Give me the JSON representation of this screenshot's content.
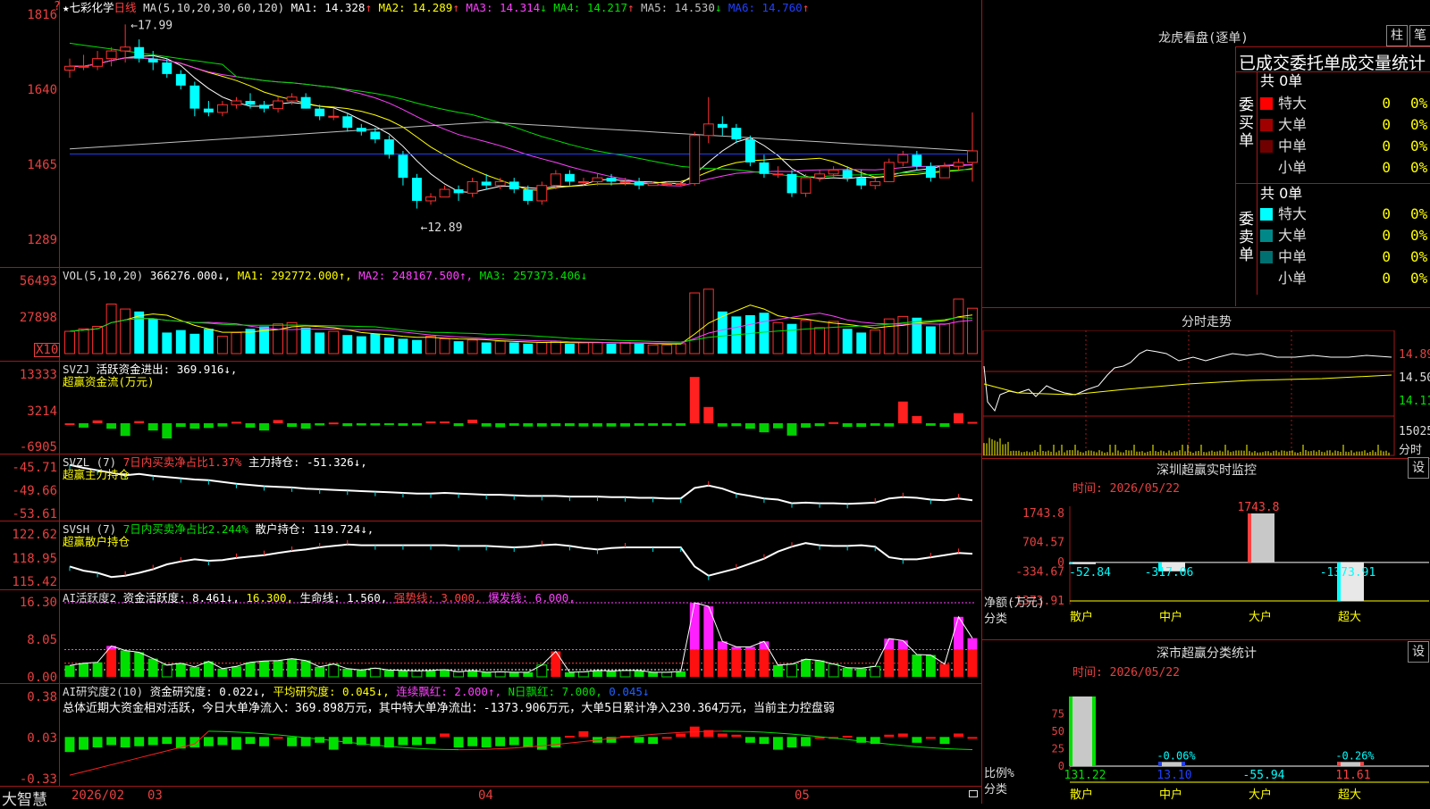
{
  "app": {
    "brand": "大智慧",
    "stock_name": "七彩化学",
    "period": "日线",
    "corner_marker": "?",
    "star": "★"
  },
  "price_pane": {
    "ma_params": "MA(5,10,20,30,60,120)",
    "ma": [
      {
        "label": "MA1:",
        "value": "14.328",
        "dir": "↑",
        "color": "#ffffff"
      },
      {
        "label": "MA2:",
        "value": "14.289",
        "dir": "↑",
        "color": "#ffff00"
      },
      {
        "label": "MA3:",
        "value": "14.314",
        "dir": "↓",
        "color": "#ff40ff"
      },
      {
        "label": "MA4:",
        "value": "14.217",
        "dir": "↑",
        "color": "#00e000"
      },
      {
        "label": "MA5:",
        "value": "14.530",
        "dir": "↓",
        "color": "#c0c0c0"
      },
      {
        "label": "MA6:",
        "value": "14.760",
        "dir": "↑",
        "color": "#2040ff"
      }
    ],
    "y_ticks": [
      "1816",
      "1640",
      "1465",
      "1289"
    ],
    "high_label": "17.99",
    "low_label": "12.89"
  },
  "volume_pane": {
    "title": "VOL(5,10,20)",
    "value": "366276.000↓,",
    "ma": [
      {
        "label": "MA1:",
        "value": "292772.000↑,",
        "color": "#ffff00"
      },
      {
        "label": "MA2:",
        "value": "248167.500↑,",
        "color": "#ff40ff"
      },
      {
        "label": "MA3:",
        "value": "257373.406↓",
        "color": "#00e000"
      }
    ],
    "y_ticks": [
      "56493",
      "27898"
    ],
    "unit": "X10"
  },
  "svzj_pane": {
    "title": "SVZJ",
    "line1": "活跃资金进出: 369.916↓,",
    "line2": "超赢资金流(万元)",
    "y_ticks": [
      "13333",
      "3214",
      "-6905"
    ]
  },
  "svzl_pane": {
    "title": "SVZL (7)",
    "part1": "7日内买卖净占比1.37%",
    "part2": "主力持仓: -51.326↓,",
    "line2": "超赢主力持仓",
    "y_ticks": [
      "-45.71",
      "-49.66",
      "-53.61"
    ]
  },
  "svsh_pane": {
    "title": "SVSH (7)",
    "part1": "7日内买卖净占比2.244%",
    "part2": "散户持仓: 119.724↓,",
    "line2": "超赢散户持仓",
    "y_ticks": [
      "122.62",
      "118.95",
      "115.42"
    ]
  },
  "ai_active_pane": {
    "title": "AI活跃度2",
    "part1": "资金活跃度: 8.461↓,",
    "part2": "16.300,",
    "part3": "生命线: 1.560,",
    "part4": "强势线: 3.000,",
    "part5": "爆发线: 6.000,",
    "y_ticks": [
      "16.30",
      "8.05",
      "0.00"
    ]
  },
  "ai_research_pane": {
    "title": "AI研究度2(10)",
    "part1": "资金研究度: 0.022↓,",
    "part2": "平均研究度: 0.045↓,",
    "part3": "连续飘红: 2.000↑,",
    "part4": "N日飘红: 7.000,",
    "part5": "0.045↓",
    "summary": "总体近期大资金相对活跃，今日大单净流入：369.898万元，其中特大单净流出：-1373.906万元，大单5日累计净入230.364万元，当前主力控盘弱",
    "y_ticks": [
      "0.38",
      "0.03",
      "-0.33"
    ]
  },
  "x_axis": {
    "labels": [
      "2026/02",
      "03",
      "04",
      "05"
    ]
  },
  "right_panel": {
    "dragon_title": "龙虎看盘(逐单)",
    "btn_column": "柱",
    "btn_detail": "笔",
    "stats_title": "已成交委托单成交量统计",
    "buy_side": {
      "side_label": "委买单",
      "total": "共 0单",
      "rows": [
        {
          "name": "特大",
          "count": "0",
          "pct": "0%",
          "color": "#ff0000"
        },
        {
          "name": "大单",
          "count": "0",
          "pct": "0%",
          "color": "#a00000"
        },
        {
          "name": "中单",
          "count": "0",
          "pct": "0%",
          "color": "#700000"
        },
        {
          "name": "小单",
          "count": "0",
          "pct": "0%",
          "color": "#000000"
        }
      ]
    },
    "sell_side": {
      "side_label": "委卖单",
      "total": "共 0单",
      "rows": [
        {
          "name": "特大",
          "count": "0",
          "pct": "0%",
          "color": "#00ffff"
        },
        {
          "name": "大单",
          "count": "0",
          "pct": "0%",
          "color": "#008888"
        },
        {
          "name": "中单",
          "count": "0",
          "pct": "0%",
          "color": "#007070"
        },
        {
          "name": "小单",
          "count": "0",
          "pct": "0%",
          "color": "#000000"
        }
      ]
    },
    "intraday": {
      "title": "分时走势",
      "price_labels": [
        "14.89",
        "14.50",
        "14.11"
      ],
      "vol_label": "15025",
      "vol_sub": "分时"
    },
    "sz_monitor": {
      "title": "深圳超赢实时监控",
      "set_btn": "设",
      "time_label": "时间: 2026/05/22",
      "y_ticks": [
        "1743.8",
        "704.57",
        "0",
        "-334.67",
        "-1373.91"
      ],
      "bars": [
        {
          "cat": "散户",
          "value": -52.84,
          "label": "-52.84"
        },
        {
          "cat": "中户",
          "value": -317.06,
          "label": "-317.06"
        },
        {
          "cat": "大户",
          "value": 1743.8,
          "label": "1743.8"
        },
        {
          "cat": "超大",
          "value": -1373.91,
          "label": "-1373.91"
        }
      ],
      "y_title": "净额(万元)",
      "x_title": "分类"
    },
    "sz_class": {
      "title": "深市超赢分类统计",
      "set_btn": "设",
      "time_label": "时间: 2026/05/22",
      "y_ticks": [
        "75",
        "50",
        "25",
        "0"
      ],
      "bars": [
        {
          "cat": "散户",
          "pct_value": 100,
          "value_label": "131.22",
          "pct_label": ""
        },
        {
          "cat": "中户",
          "pct_value": 6,
          "value_label": "13.10",
          "pct_label": "-0.06%"
        },
        {
          "cat": "大户",
          "pct_value": 0,
          "value_label": "-55.94",
          "pct_label": ""
        },
        {
          "cat": "超大",
          "pct_value": 6,
          "value_label": "11.61",
          "pct_label": "-0.26%"
        }
      ],
      "y_title": "比例%",
      "x_title": "分类"
    }
  },
  "chart_data": [
    {
      "type": "candlestick",
      "title": "七彩化学 日线",
      "ylim": [
        12.4,
        18.3
      ],
      "y_ticks": [
        18.16,
        16.4,
        14.65,
        12.89
      ],
      "candles": [
        [
          16.8,
          17.1,
          16.6,
          16.9
        ],
        [
          16.9,
          17.2,
          16.8,
          16.9
        ],
        [
          16.9,
          17.3,
          16.8,
          17.1
        ],
        [
          17.1,
          17.4,
          16.9,
          17.3
        ],
        [
          17.3,
          17.99,
          17.0,
          17.4
        ],
        [
          17.4,
          17.6,
          17.0,
          17.1
        ],
        [
          17.1,
          17.3,
          16.8,
          17.0
        ],
        [
          17.0,
          17.1,
          16.6,
          16.7
        ],
        [
          16.7,
          16.8,
          16.3,
          16.4
        ],
        [
          16.4,
          16.5,
          15.6,
          15.8
        ],
        [
          15.8,
          16.0,
          15.6,
          15.7
        ],
        [
          15.7,
          16.0,
          15.6,
          15.9
        ],
        [
          15.9,
          16.1,
          15.8,
          16.0
        ],
        [
          16.0,
          16.2,
          15.8,
          15.9
        ],
        [
          15.9,
          16.0,
          15.7,
          15.8
        ],
        [
          15.8,
          16.1,
          15.7,
          16.0
        ],
        [
          16.0,
          16.2,
          15.9,
          16.1
        ],
        [
          16.1,
          16.2,
          15.8,
          15.8
        ],
        [
          15.8,
          15.9,
          15.5,
          15.6
        ],
        [
          15.6,
          15.8,
          15.5,
          15.6
        ],
        [
          15.6,
          15.7,
          15.2,
          15.3
        ],
        [
          15.3,
          15.4,
          15.1,
          15.2
        ],
        [
          15.2,
          15.3,
          14.9,
          15.0
        ],
        [
          15.0,
          15.1,
          14.5,
          14.6
        ],
        [
          14.6,
          14.7,
          13.8,
          14.0
        ],
        [
          14.0,
          14.1,
          13.2,
          13.4
        ],
        [
          13.4,
          13.6,
          13.3,
          13.5
        ],
        [
          13.5,
          13.8,
          13.5,
          13.7
        ],
        [
          13.7,
          13.8,
          13.4,
          13.6
        ],
        [
          13.6,
          14.0,
          13.5,
          13.9
        ],
        [
          13.9,
          14.1,
          13.7,
          13.8
        ],
        [
          13.8,
          14.0,
          13.7,
          13.9
        ],
        [
          13.9,
          14.0,
          13.6,
          13.7
        ],
        [
          13.7,
          13.8,
          13.3,
          13.4
        ],
        [
          13.4,
          13.9,
          13.3,
          13.8
        ],
        [
          13.8,
          14.2,
          13.7,
          14.1
        ],
        [
          14.1,
          14.2,
          13.8,
          13.9
        ],
        [
          13.9,
          14.0,
          13.8,
          13.9
        ],
        [
          13.9,
          14.1,
          13.8,
          14.0
        ],
        [
          14.0,
          14.1,
          13.8,
          13.9
        ],
        [
          13.9,
          14.0,
          13.8,
          13.9
        ],
        [
          13.9,
          14.0,
          13.7,
          13.8
        ],
        [
          13.8,
          13.9,
          13.8,
          13.85
        ],
        [
          13.85,
          13.9,
          13.8,
          13.85
        ],
        [
          13.85,
          13.9,
          13.8,
          13.85
        ],
        [
          13.85,
          15.2,
          13.8,
          15.1
        ],
        [
          15.1,
          16.1,
          14.9,
          15.4
        ],
        [
          15.4,
          15.6,
          15.1,
          15.3
        ],
        [
          15.3,
          15.4,
          14.9,
          15.0
        ],
        [
          15.0,
          15.1,
          14.3,
          14.4
        ],
        [
          14.4,
          14.6,
          14.0,
          14.1
        ],
        [
          14.1,
          14.3,
          14.0,
          14.1
        ],
        [
          14.1,
          14.2,
          13.5,
          13.6
        ],
        [
          13.6,
          14.1,
          13.5,
          14.0
        ],
        [
          14.0,
          14.2,
          13.9,
          14.1
        ],
        [
          14.1,
          14.3,
          14.0,
          14.2
        ],
        [
          14.2,
          14.3,
          13.9,
          14.0
        ],
        [
          14.0,
          14.2,
          13.7,
          13.8
        ],
        [
          13.8,
          14.0,
          13.7,
          13.9
        ],
        [
          13.9,
          14.5,
          13.9,
          14.4
        ],
        [
          14.4,
          14.7,
          14.3,
          14.6
        ],
        [
          14.6,
          14.7,
          14.2,
          14.3
        ],
        [
          14.3,
          14.4,
          13.9,
          14.0
        ],
        [
          14.0,
          14.4,
          14.0,
          14.3
        ],
        [
          14.3,
          14.5,
          14.2,
          14.4
        ],
        [
          14.4,
          15.7,
          13.9,
          14.7
        ]
      ]
    },
    {
      "type": "bar",
      "title": "VOL(5,10,20)",
      "ylim": [
        0,
        62000
      ],
      "values": [
        18000,
        20000,
        22000,
        40000,
        36000,
        34000,
        28000,
        17000,
        19000,
        16000,
        20000,
        14000,
        17000,
        20000,
        22000,
        24000,
        25000,
        21000,
        17000,
        18000,
        15000,
        14000,
        16000,
        13000,
        12000,
        11000,
        14000,
        12000,
        10000,
        11000,
        9000,
        10000,
        9000,
        8000,
        9000,
        10000,
        8000,
        9000,
        9000,
        8000,
        9000,
        8000,
        7000,
        7000,
        8000,
        49000,
        52000,
        34000,
        30000,
        31000,
        33000,
        25000,
        24000,
        27000,
        21000,
        26000,
        20000,
        17000,
        19000,
        28000,
        30000,
        29000,
        22000,
        24000,
        44000,
        36627
      ]
    },
    {
      "type": "bar",
      "title": "SVZJ 超赢资金流(万元)",
      "ylim": [
        -6905,
        13333
      ],
      "values": [
        0,
        -1200,
        800,
        -1500,
        -3500,
        600,
        -2000,
        -4200,
        -1000,
        -1500,
        -1300,
        -900,
        400,
        -1200,
        -2000,
        900,
        -1000,
        -1500,
        -600,
        200,
        -800,
        -600,
        -600,
        -500,
        -700,
        -600,
        500,
        500,
        -800,
        1000,
        -900,
        -1100,
        -700,
        -900,
        -900,
        -800,
        -800,
        -900,
        -900,
        -900,
        -900,
        -700,
        -700,
        -700,
        -700,
        12800,
        4500,
        -900,
        -800,
        -1500,
        -2500,
        -1400,
        -3400,
        -1200,
        -800,
        300,
        -1000,
        -1000,
        -700,
        -900,
        6000,
        2000,
        -700,
        -1000,
        2800,
        370
      ]
    },
    {
      "type": "line",
      "title": "SVZL 超赢主力持仓",
      "ylim": [
        -53.61,
        -45.71
      ],
      "values": [
        -45.5,
        -46.0,
        -46.4,
        -46.8,
        -47.2,
        -47.0,
        -47.3,
        -47.5,
        -47.7,
        -47.9,
        -48.0,
        -48.3,
        -48.6,
        -48.8,
        -49.0,
        -49.1,
        -49.2,
        -49.4,
        -49.5,
        -49.6,
        -49.7,
        -49.8,
        -49.9,
        -50.0,
        -50.1,
        -50.2,
        -50.2,
        -50.1,
        -50.2,
        -50.3,
        -50.4,
        -50.4,
        -50.5,
        -50.6,
        -50.6,
        -50.6,
        -50.7,
        -50.7,
        -50.7,
        -50.8,
        -50.8,
        -50.9,
        -50.9,
        -51.0,
        -51.0,
        -49.3,
        -48.9,
        -49.4,
        -50.2,
        -50.6,
        -51.0,
        -51.2,
        -51.8,
        -51.7,
        -51.8,
        -51.8,
        -51.9,
        -51.8,
        -51.7,
        -51.0,
        -50.8,
        -50.9,
        -51.2,
        -51.3,
        -51.0,
        -51.3
      ]
    },
    {
      "type": "line",
      "title": "SVSH 超赢散户持仓",
      "ylim": [
        115.42,
        122.62
      ],
      "values": [
        117.9,
        117.3,
        117.0,
        116.4,
        116.6,
        117.0,
        117.5,
        118.2,
        118.6,
        118.9,
        118.7,
        118.8,
        119.1,
        119.3,
        119.5,
        119.8,
        120.1,
        120.3,
        120.6,
        120.8,
        121.0,
        120.9,
        120.9,
        120.9,
        120.9,
        120.9,
        120.9,
        120.9,
        120.8,
        120.8,
        120.8,
        120.7,
        120.6,
        120.7,
        120.9,
        121.0,
        120.8,
        120.5,
        120.3,
        120.5,
        120.6,
        120.6,
        120.6,
        120.6,
        120.6,
        117.9,
        116.6,
        117.1,
        117.6,
        118.3,
        119.0,
        120.0,
        120.7,
        121.2,
        120.9,
        120.8,
        120.8,
        120.9,
        120.7,
        119.2,
        118.9,
        118.9,
        119.2,
        119.5,
        119.8,
        119.7
      ]
    },
    {
      "type": "bar",
      "title": "AI活跃度2",
      "ylim": [
        0,
        16.3
      ],
      "values": [
        2.5,
        3.0,
        3.2,
        6.8,
        5.8,
        5.4,
        4.0,
        2.6,
        3.0,
        2.2,
        3.4,
        1.8,
        2.3,
        3.2,
        3.5,
        3.6,
        4.0,
        3.6,
        2.2,
        2.8,
        1.8,
        1.5,
        1.9,
        1.5,
        1.4,
        1.3,
        1.4,
        1.6,
        1.1,
        1.4,
        1.0,
        1.1,
        1.0,
        1.0,
        2.6,
        5.6,
        1.0,
        1.1,
        1.4,
        1.3,
        1.4,
        1.4,
        1.0,
        1.0,
        1.2,
        16.3,
        15.5,
        7.8,
        6.6,
        6.6,
        7.8,
        2.6,
        2.8,
        3.9,
        3.6,
        2.8,
        2.0,
        1.9,
        2.3,
        8.4,
        8.0,
        4.9,
        4.8,
        2.8,
        13.2,
        8.5
      ],
      "hlines": [
        16.3,
        6.0,
        3.0,
        1.56
      ]
    },
    {
      "type": "bar",
      "title": "AI研究度2(10)",
      "ylim": [
        -0.33,
        0.38
      ],
      "values": [
        -0.1,
        -0.08,
        -0.06,
        -0.04,
        -0.06,
        -0.05,
        -0.04,
        -0.03,
        -0.07,
        -0.06,
        -0.05,
        -0.04,
        -0.08,
        -0.03,
        -0.05,
        0.02,
        -0.05,
        -0.05,
        -0.02,
        -0.08,
        -0.03,
        -0.04,
        -0.05,
        -0.06,
        -0.04,
        -0.04,
        -0.03,
        0.06,
        -0.06,
        -0.05,
        -0.06,
        -0.05,
        -0.04,
        -0.06,
        -0.08,
        -0.06,
        0.04,
        0.08,
        -0.02,
        -0.02,
        0.04,
        -0.02,
        -0.03,
        0.03,
        0.06,
        0.12,
        0.09,
        0.06,
        0.05,
        -0.02,
        -0.03,
        -0.08,
        -0.06,
        -0.05,
        0.03,
        0.02,
        0.04,
        -0.02,
        -0.03,
        0.05,
        0.06,
        -0.02,
        0.02,
        -0.03,
        0.06,
        0.02
      ]
    }
  ]
}
